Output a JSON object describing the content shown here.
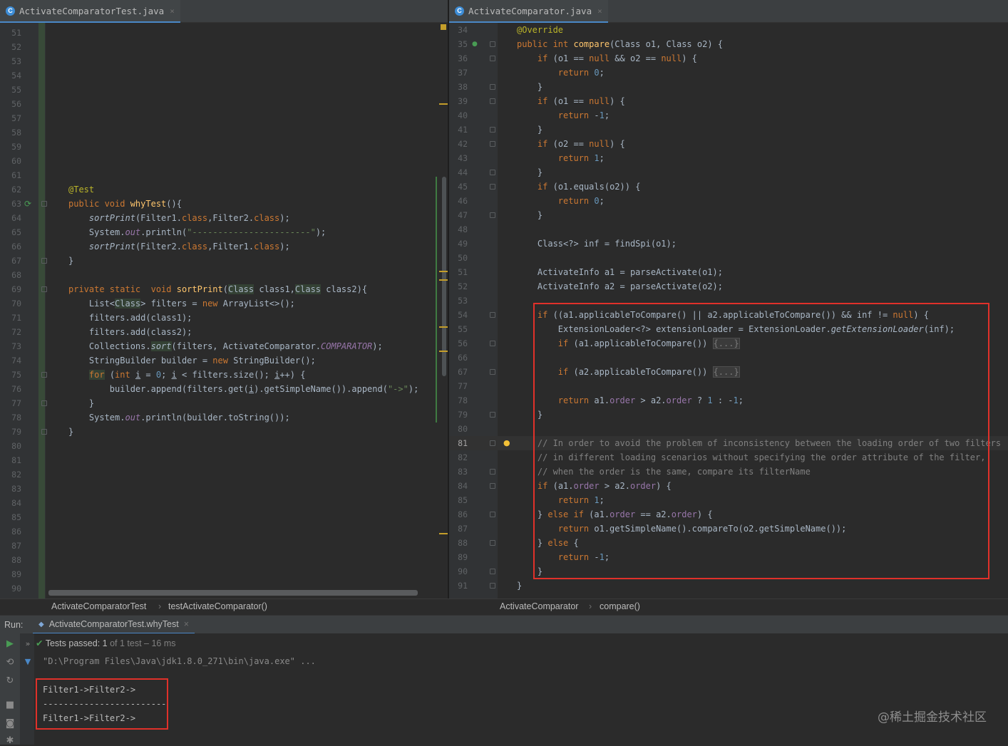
{
  "left_editor": {
    "tab": {
      "icon": "C",
      "label": "ActivateComparatorTest.java",
      "close": "×"
    },
    "lines": [
      {
        "n": "51",
        "t": ""
      },
      {
        "n": "52",
        "t": ""
      },
      {
        "n": "53",
        "t": ""
      },
      {
        "n": "54",
        "t": ""
      },
      {
        "n": "55",
        "t": ""
      },
      {
        "n": "56",
        "t": ""
      },
      {
        "n": "57",
        "t": ""
      },
      {
        "n": "58",
        "t": ""
      },
      {
        "n": "59",
        "t": ""
      },
      {
        "n": "60",
        "t": ""
      },
      {
        "n": "61",
        "t": ""
      },
      {
        "n": "62",
        "t": "<span class='ann'>@Test</span>"
      },
      {
        "n": "63",
        "t": "<span class='kw'>public void </span><span class='mth'>whyTest</span>(){",
        "fold": true,
        "run": true
      },
      {
        "n": "64",
        "t": "    <span class='it'>sortPrint</span>(Filter1.<span class='kw'>class</span>,Filter2.<span class='kw'>class</span>);"
      },
      {
        "n": "65",
        "t": "    System.<span class='sfl'>out</span>.println(<span class='str'>\"-----------------------\"</span>);"
      },
      {
        "n": "66",
        "t": "    <span class='it'>sortPrint</span>(Filter2.<span class='kw'>class</span>,Filter1.<span class='kw'>class</span>);"
      },
      {
        "n": "67",
        "t": "}",
        "fold": true
      },
      {
        "n": "68",
        "t": ""
      },
      {
        "n": "69",
        "t": "<span class='kw'>private static  void </span><span class='mth'>sortPrint</span>(<span class='hl'>Class</span> class1,<span class='hl'>Class</span> class2){",
        "fold": true
      },
      {
        "n": "70",
        "t": "    List&lt;<span class='hl'>Class</span>&gt; filters = <span class='kw'>new </span>ArrayList&lt;&gt;();"
      },
      {
        "n": "71",
        "t": "    filters.add(class1);"
      },
      {
        "n": "72",
        "t": "    filters.add(class2);"
      },
      {
        "n": "73",
        "t": "    Collections.<span class='it hl'>sort</span>(filters, ActivateComparator.<span class='sfl'>COMPARATOR</span>);"
      },
      {
        "n": "74",
        "t": "    StringBuilder builder = <span class='kw'>new </span>StringBuilder();"
      },
      {
        "n": "75",
        "t": "    <span class='kw hl'>for</span> (<span class='kw'>int </span><span class='ul'>i</span> = <span class='num'>0</span>; <span class='ul'>i</span> &lt; filters.size(); <span class='ul'>i</span>++) {",
        "fold": true
      },
      {
        "n": "76",
        "t": "        builder.append(filters.get(<span class='ul'>i</span>).getSimpleName()).append(<span class='str'>\"-&gt;\"</span>);"
      },
      {
        "n": "77",
        "t": "    }",
        "fold": true
      },
      {
        "n": "78",
        "t": "    System.<span class='sfl'>out</span>.println(builder.toString());"
      },
      {
        "n": "79",
        "t": "}",
        "fold": true
      },
      {
        "n": "80",
        "t": ""
      },
      {
        "n": "81",
        "t": ""
      },
      {
        "n": "82",
        "t": ""
      },
      {
        "n": "83",
        "t": ""
      },
      {
        "n": "84",
        "t": ""
      },
      {
        "n": "85",
        "t": ""
      },
      {
        "n": "86",
        "t": ""
      },
      {
        "n": "87",
        "t": ""
      },
      {
        "n": "88",
        "t": ""
      },
      {
        "n": "89",
        "t": ""
      },
      {
        "n": "90",
        "t": ""
      }
    ]
  },
  "right_editor": {
    "tab": {
      "icon": "C",
      "label": "ActivateComparator.java",
      "close": "×"
    },
    "lines": [
      {
        "n": "34",
        "t": "<span class='ann'>@Override</span>"
      },
      {
        "n": "35",
        "t": "<span class='kw'>public int </span><span class='mth'>compare</span>(Class o1, Class o2) {",
        "fold": true,
        "override": true
      },
      {
        "n": "36",
        "t": "    <span class='kw'>if </span>(o1 == <span class='kw'>null </span>&amp;&amp; o2 == <span class='kw'>null</span>) {",
        "fold": true
      },
      {
        "n": "37",
        "t": "        <span class='kw'>return </span><span class='num'>0</span>;"
      },
      {
        "n": "38",
        "t": "    }",
        "fold": true
      },
      {
        "n": "39",
        "t": "    <span class='kw'>if </span>(o1 == <span class='kw'>null</span>) {",
        "fold": true
      },
      {
        "n": "40",
        "t": "        <span class='kw'>return </span>-<span class='num'>1</span>;"
      },
      {
        "n": "41",
        "t": "    }",
        "fold": true
      },
      {
        "n": "42",
        "t": "    <span class='kw'>if </span>(o2 == <span class='kw'>null</span>) {",
        "fold": true
      },
      {
        "n": "43",
        "t": "        <span class='kw'>return </span><span class='num'>1</span>;"
      },
      {
        "n": "44",
        "t": "    }",
        "fold": true
      },
      {
        "n": "45",
        "t": "    <span class='kw'>if </span>(o1.equals(o2)) {",
        "fold": true
      },
      {
        "n": "46",
        "t": "        <span class='kw'>return </span><span class='num'>0</span>;"
      },
      {
        "n": "47",
        "t": "    }",
        "fold": true
      },
      {
        "n": "48",
        "t": ""
      },
      {
        "n": "49",
        "t": "    Class&lt;?&gt; inf = findSpi(o1);"
      },
      {
        "n": "50",
        "t": ""
      },
      {
        "n": "51",
        "t": "    ActivateInfo a1 = parseActivate(o1);"
      },
      {
        "n": "52",
        "t": "    ActivateInfo a2 = parseActivate(o2);"
      },
      {
        "n": "53",
        "t": ""
      },
      {
        "n": "54",
        "t": "    <span class='kw'>if </span>((a1.applicableToCompare() || a2.applicableToCompare()) &amp;&amp; inf != <span class='kw'>null</span>) {",
        "fold": true
      },
      {
        "n": "55",
        "t": "        ExtensionLoader&lt;?&gt; extensionLoader = ExtensionLoader.<span class='it'>getExtensionLoader</span>(inf);"
      },
      {
        "n": "56",
        "t": "        <span class='kw'>if </span>(a1.applicableToCompare()) <span class='fb'>{...}</span>",
        "fold": true
      },
      {
        "n": "66",
        "t": ""
      },
      {
        "n": "67",
        "t": "        <span class='kw'>if </span>(a2.applicableToCompare()) <span class='fb'>{...}</span>",
        "fold": true
      },
      {
        "n": "77",
        "t": ""
      },
      {
        "n": "78",
        "t": "        <span class='kw'>return </span>a1.<span class='fld'>order</span> &gt; a2.<span class='fld'>order</span> ? <span class='num'>1</span> : -<span class='num'>1</span>;"
      },
      {
        "n": "79",
        "t": "    }",
        "fold": true
      },
      {
        "n": "80",
        "t": ""
      },
      {
        "n": "81",
        "t": "    <span class='cmt'>// In order to avoid the problem of inconsistency between the loading order of two filters</span>",
        "fold": true,
        "bulb": true,
        "cur": true
      },
      {
        "n": "82",
        "t": "    <span class='cmt'>// in different loading scenarios without specifying the order attribute of the filter,</span>"
      },
      {
        "n": "83",
        "t": "    <span class='cmt'>// when the order is the same, compare its filterName</span>",
        "fold": true
      },
      {
        "n": "84",
        "t": "    <span class='kw'>if </span>(a1.<span class='fld'>order</span> &gt; a2.<span class='fld'>order</span>) {",
        "fold": true
      },
      {
        "n": "85",
        "t": "        <span class='kw'>return </span><span class='num'>1</span>;"
      },
      {
        "n": "86",
        "t": "    } <span class='kw'>else if </span>(a1.<span class='fld'>order</span> == a2.<span class='fld'>order</span>) {",
        "fold": true
      },
      {
        "n": "87",
        "t": "        <span class='kw'>return </span>o1.getSimpleName().compareTo(o2.getSimpleName());"
      },
      {
        "n": "88",
        "t": "    } <span class='kw'>else </span>{",
        "fold": true
      },
      {
        "n": "89",
        "t": "        <span class='kw'>return </span>-<span class='num'>1</span>;"
      },
      {
        "n": "90",
        "t": "    }",
        "fold": true
      },
      {
        "n": "91",
        "t": "}",
        "fold": true
      }
    ]
  },
  "breadcrumbs": {
    "left": [
      "ActivateComparatorTest",
      "testActivateComparator()"
    ],
    "right": [
      "ActivateComparator",
      "compare()"
    ],
    "separator": "›"
  },
  "run_panel": {
    "label": "Run:",
    "tab_label": "ActivateComparatorTest.whyTest",
    "tab_close": "×",
    "status_prefix": "Tests passed:",
    "status_count": "1",
    "status_suffix": "of 1 test – 16 ms",
    "command": "\"D:\\Program Files\\Java\\jdk1.8.0_271\\bin\\java.exe\" ...",
    "output": [
      "Filter1->Filter2->",
      "------------------------",
      "Filter1->Filter2->"
    ]
  },
  "watermark": "@稀土掘金技术社区",
  "colors": {
    "accent": "#4a88c7",
    "highlight_box": "#e0312a",
    "pass_green": "#499c54"
  }
}
